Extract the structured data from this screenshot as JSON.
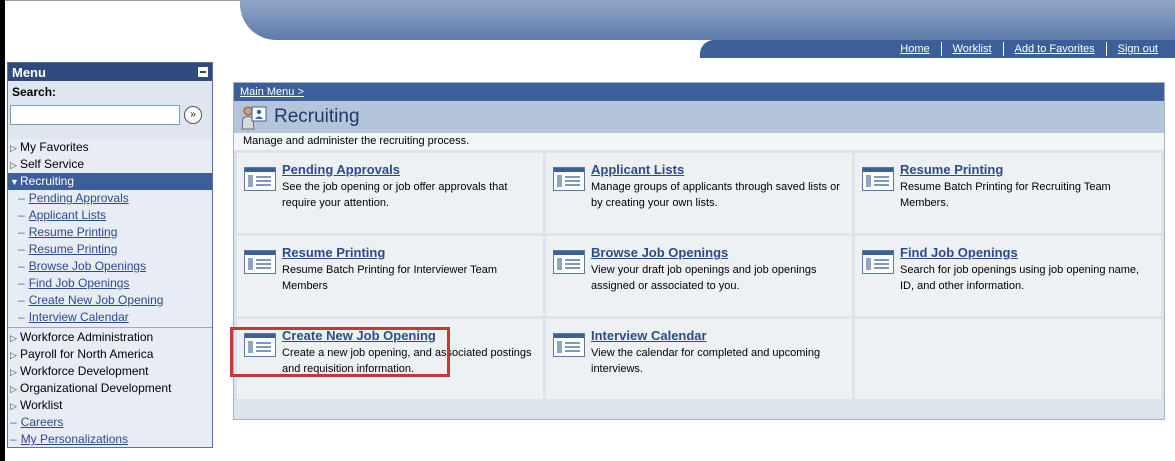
{
  "header": {
    "links": [
      "Home",
      "Worklist",
      "Add to Favorites",
      "Sign out"
    ]
  },
  "menu": {
    "title": "Menu",
    "search_label": "Search:",
    "search_value": "",
    "items_top": [
      {
        "label": "My Favorites",
        "expanded": false
      },
      {
        "label": "Self Service",
        "expanded": false
      }
    ],
    "active": {
      "label": "Recruiting"
    },
    "sub_items": [
      "Pending Approvals",
      "Applicant Lists",
      "Resume Printing",
      "Resume Printing",
      "Browse Job Openings",
      "Find Job Openings",
      "Create New Job Opening",
      "Interview Calendar"
    ],
    "items_bottom": [
      {
        "label": "Workforce Administration"
      },
      {
        "label": "Payroll for North America"
      },
      {
        "label": "Workforce Development"
      },
      {
        "label": "Organizational Development"
      },
      {
        "label": "Worklist"
      }
    ],
    "links_bottom": [
      "Careers",
      "My Personalizations"
    ]
  },
  "content": {
    "breadcrumb": "Main Menu >",
    "title": "Recruiting",
    "description": "Manage and administer the recruiting process.",
    "tiles": [
      {
        "title": "Pending Approvals",
        "desc": "See the job opening or job offer approvals that require your attention."
      },
      {
        "title": "Applicant Lists",
        "desc": "Manage groups of applicants through saved lists or by creating your own lists."
      },
      {
        "title": "Resume Printing",
        "desc": "Resume Batch Printing for Recruiting Team Members."
      },
      {
        "title": "Resume Printing",
        "desc": "Resume Batch Printing for Interviewer Team Members"
      },
      {
        "title": "Browse Job Openings",
        "desc": "View your draft job openings and job openings assigned or associated to you."
      },
      {
        "title": "Find Job Openings",
        "desc": "Search for job openings using job opening name, ID, and other information."
      },
      {
        "title": "Create New Job Opening",
        "desc": "Create a new job opening, and associated postings and requisition information."
      },
      {
        "title": "Interview Calendar",
        "desc": "View the calendar for completed and upcoming interviews."
      }
    ]
  },
  "colors": {
    "nav_bar": "#3d5f99",
    "menu_header": "#314a7e",
    "link": "#2c4a8c",
    "highlight": "#c0393b"
  }
}
